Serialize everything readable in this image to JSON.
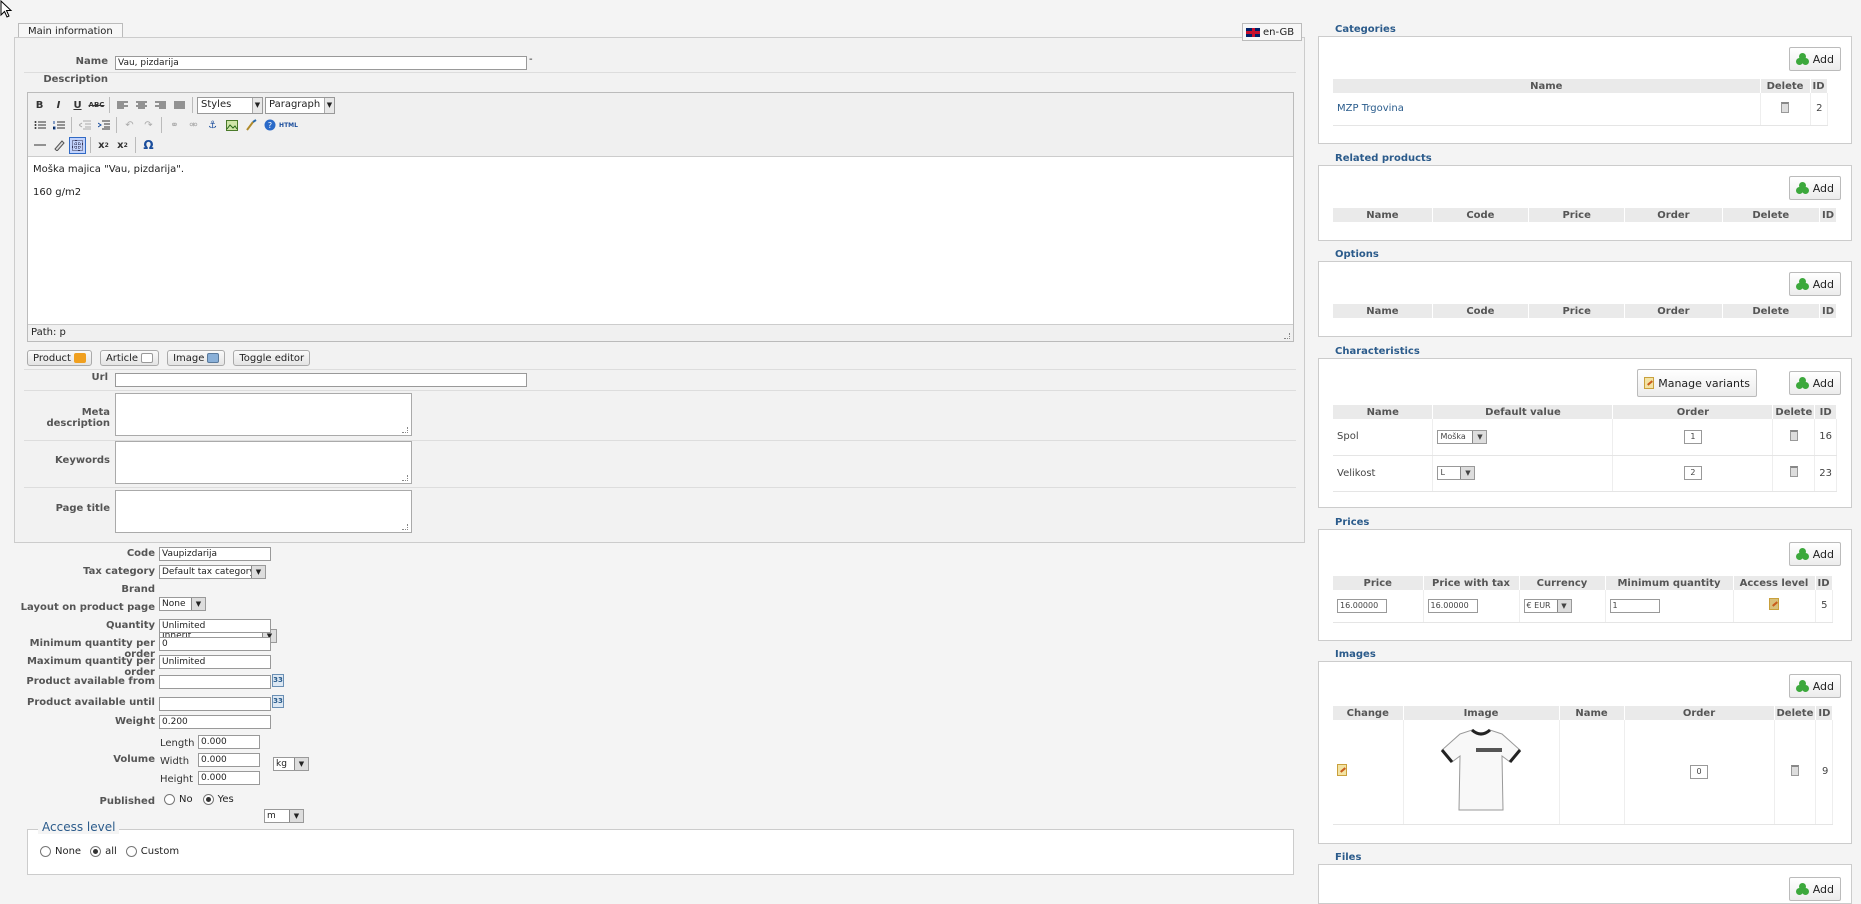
{
  "main": {
    "tab_label": "Main information",
    "language": "en-GB",
    "name_label": "Name",
    "name_value": "Vau, pizdarija",
    "name_required_mark": "-",
    "description_label": "Description",
    "editor": {
      "styles_select": "Styles",
      "format_select": "Paragraph",
      "content_line1": "Moška majica \"Vau, pizdarija\".",
      "content_line2": "160 g/m2",
      "path_text": "Path: p",
      "toolbar_row1": [
        "B",
        "I",
        "U",
        "ABC"
      ],
      "special_char": "Ω"
    },
    "insert_buttons": {
      "product": "Product",
      "article": "Article",
      "image": "Image",
      "toggle": "Toggle editor"
    },
    "url_label": "Url",
    "meta_description_label": "Meta description",
    "keywords_label": "Keywords",
    "page_title_label": "Page title"
  },
  "fields": {
    "code_label": "Code",
    "code_value": "Vaupizdarija",
    "tax_label": "Tax category",
    "tax_value": "Default tax category",
    "brand_label": "Brand",
    "brand_value": "None",
    "layout_label": "Layout on product page",
    "layout_value": "Inherit",
    "quantity_label": "Quantity",
    "quantity_value": "Unlimited",
    "min_qty_label": "Minimum quantity per order",
    "min_qty_value": "0",
    "max_qty_label": "Maximum quantity per order",
    "max_qty_value": "Unlimited",
    "avail_from_label": "Product available from",
    "avail_until_label": "Product available until",
    "calendar_text": "33",
    "weight_label": "Weight",
    "weight_value": "0.200",
    "weight_unit": "kg",
    "volume_label": "Volume",
    "length_label": "Length",
    "length_value": "0.000",
    "width_label": "Width",
    "width_value": "0.000",
    "volume_unit": "m",
    "height_label": "Height",
    "height_value": "0.000",
    "published_label": "Published",
    "published_no": "No",
    "published_yes": "Yes"
  },
  "access": {
    "legend": "Access level",
    "none": "None",
    "all": "all",
    "custom": "Custom"
  },
  "right": {
    "add_label": "Add",
    "categories": {
      "legend": "Categories",
      "headers": [
        "Name",
        "Delete",
        "ID"
      ],
      "row": {
        "name": "MZP Trgovina",
        "id": "2"
      }
    },
    "related": {
      "legend": "Related products",
      "headers": [
        "Name",
        "Code",
        "Price",
        "Order",
        "Delete",
        "ID"
      ]
    },
    "options": {
      "legend": "Options",
      "headers": [
        "Name",
        "Code",
        "Price",
        "Order",
        "Delete",
        "ID"
      ]
    },
    "characteristics": {
      "legend": "Characteristics",
      "manage_variants": "Manage variants",
      "headers": [
        "Name",
        "Default value",
        "Order",
        "Delete",
        "ID"
      ],
      "rows": [
        {
          "name": "Spol",
          "value": "Moška",
          "order": "1",
          "id": "16"
        },
        {
          "name": "Velikost",
          "value": "L",
          "order": "2",
          "id": "23"
        }
      ]
    },
    "prices": {
      "legend": "Prices",
      "headers": [
        "Price",
        "Price with tax",
        "Currency",
        "Minimum quantity",
        "Access level",
        "ID"
      ],
      "row": {
        "price": "16.00000",
        "price_tax": "16.00000",
        "currency": "€ EUR",
        "min_qty": "1",
        "id": "5"
      }
    },
    "images": {
      "legend": "Images",
      "headers": [
        "Change",
        "Image",
        "Name",
        "Order",
        "Delete",
        "ID"
      ],
      "row": {
        "order": "0",
        "id": "9"
      }
    },
    "files": {
      "legend": "Files"
    }
  }
}
